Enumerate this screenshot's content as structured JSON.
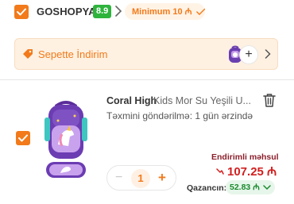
{
  "seller": {
    "name": "GOSHOPYA",
    "rating": "8.9",
    "minimum": "Minimum 10 ₼"
  },
  "discount_banner": {
    "label": "Sepette İndirim"
  },
  "product": {
    "brand": "Coral High",
    "name": "Kids Mor Su Yeşili U...",
    "delivery": "Təxmini göndərilmə: 1 gün ərzində",
    "quantity": "1",
    "price_label": "Endirimli məhsul",
    "price": "107.25 ₼",
    "gain_label": "Qazancın:",
    "gain_value": "52.83 ₼"
  },
  "colors": {
    "accent": "#f27a1a",
    "rating_bg": "#2eb33d",
    "price_red": "#d21f1f",
    "gain_green": "#1b8a2e"
  },
  "icons": {
    "seller_checkbox": "checkbox-checked-icon",
    "seller_arrow": "chevron-right-icon",
    "minimum_status": "check-icon",
    "discount": "tag-icon",
    "banner_add": "plus-icon",
    "banner_arrow": "chevron-right-icon",
    "delete": "trash-icon",
    "price_trend": "down-arrow-icon",
    "gain_toggle": "chevron-down-icon"
  }
}
